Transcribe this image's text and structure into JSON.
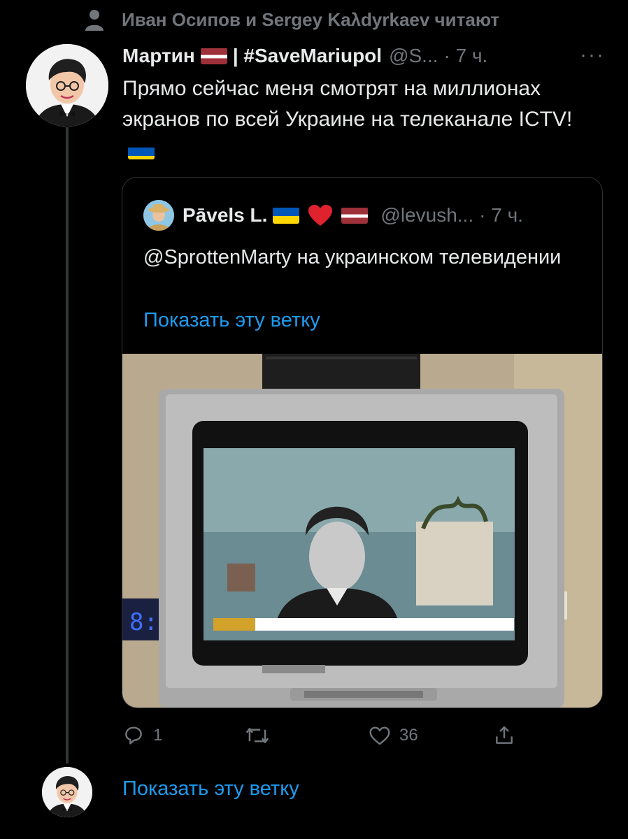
{
  "social_context": {
    "text": "Иван Осипов и Sergey Kaλdyrkaev читают",
    "icon": "person-icon"
  },
  "tweet": {
    "author_name": "Мартин",
    "name_suffix": "| #SaveMariupol",
    "handle": "@S...",
    "time": "· 7 ч.",
    "more": "···",
    "text": "Прямо сейчас меня смотрят на миллионах экранов по всей Украине на телеканале ICTV!"
  },
  "quote": {
    "author_name": "Pāvels L.",
    "handle": "@levush...",
    "time": "· 7 ч.",
    "text": "@SprottenMarty на украинском телевидении",
    "show_thread": "Показать эту ветку"
  },
  "actions": {
    "reply_count": "1",
    "retweet_count": "",
    "like_count": "36"
  },
  "bottom": {
    "show_thread": "Показать эту ветку"
  },
  "colors": {
    "background": "#000000",
    "text": "#e7e9ea",
    "muted": "#71767b",
    "link": "#1d9bf0",
    "border": "#2f3336"
  }
}
